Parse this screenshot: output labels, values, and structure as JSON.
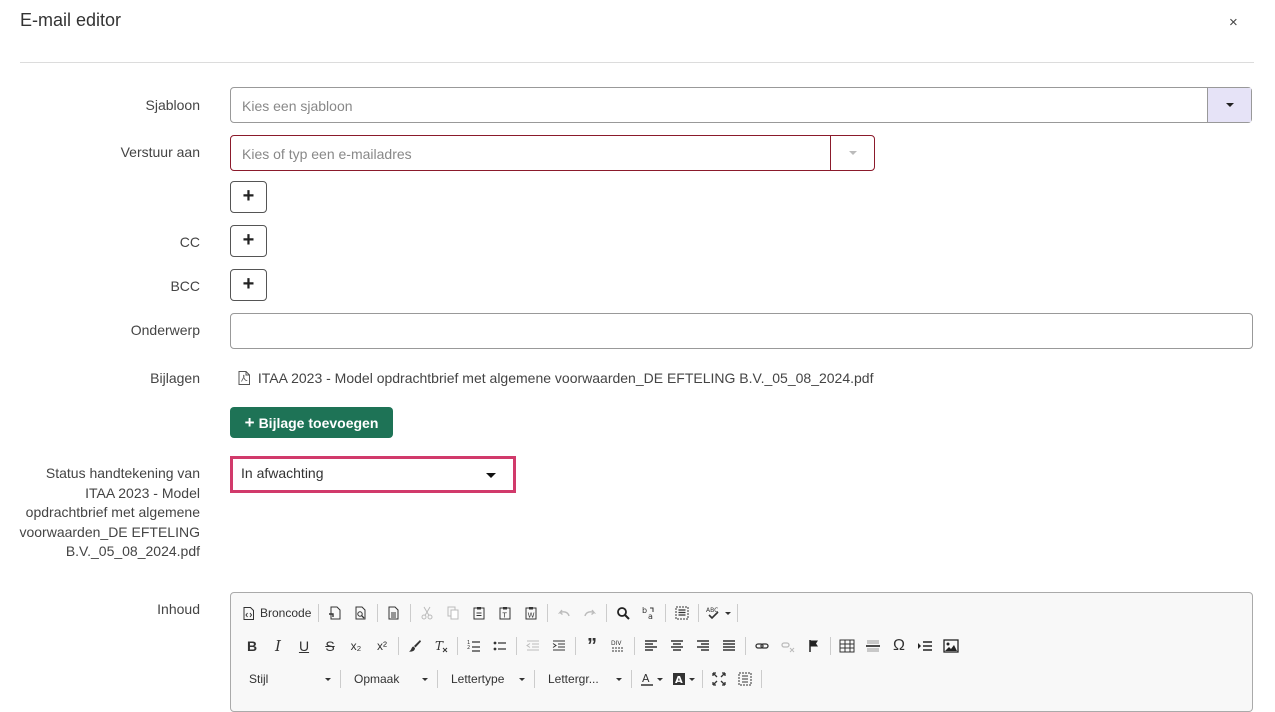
{
  "header": {
    "title": "E-mail editor",
    "close": "×"
  },
  "form": {
    "sjabloon": {
      "label": "Sjabloon",
      "placeholder": "Kies een sjabloon"
    },
    "verstuur": {
      "label": "Verstuur aan",
      "placeholder": "Kies of typ een e-mailadres"
    },
    "cc": {
      "label": "CC"
    },
    "bcc": {
      "label": "BCC"
    },
    "onderwerp": {
      "label": "Onderwerp",
      "value": ""
    },
    "bijlagen": {
      "label": "Bijlagen",
      "file": "ITAA 2023 - Model opdrachtbrief met algemene voorwaarden_DE EFTELING B.V._05_08_2024.pdf",
      "add_button": "Bijlage toevoegen"
    },
    "status": {
      "label": "Status handtekening van ITAA 2023 - Model opdrachtbrief met algemene voorwaarden_DE EFTELING B.V._05_08_2024.pdf",
      "value": "In afwachting"
    },
    "inhoud": {
      "label": "Inhoud"
    }
  },
  "toolbar": {
    "source": "Broncode",
    "styles": "Stijl",
    "format": "Opmaak",
    "font": "Lettertype",
    "size": "Lettergr...",
    "subscript": "x₂",
    "superscript": "x²",
    "omega": "Ω"
  },
  "colors": {
    "accent_green": "#1e7356",
    "highlight": "#d13a6b",
    "dropdown_bg": "#e6e3f7"
  }
}
